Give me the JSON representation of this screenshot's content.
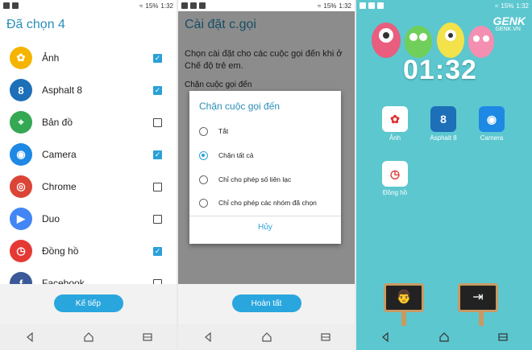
{
  "screen1": {
    "status": {
      "battery": "15%",
      "time": "1:32"
    },
    "title": "Đã chọn 4",
    "apps": [
      {
        "label": "Ảnh",
        "checked": true,
        "icon": "photos-pinwheel-icon",
        "glyph": "✿",
        "color": "#f4b400"
      },
      {
        "label": "Asphalt 8",
        "checked": true,
        "icon": "asphalt-8-icon",
        "glyph": "8",
        "color": "#1d6fb8"
      },
      {
        "label": "Bản đồ",
        "checked": false,
        "icon": "maps-icon",
        "glyph": "⌖",
        "color": "#34a853"
      },
      {
        "label": "Camera",
        "checked": true,
        "icon": "camera-icon",
        "glyph": "◉",
        "color": "#1e88e5"
      },
      {
        "label": "Chrome",
        "checked": false,
        "icon": "chrome-icon",
        "glyph": "◎",
        "color": "#db4437"
      },
      {
        "label": "Duo",
        "checked": false,
        "icon": "duo-icon",
        "glyph": "▶",
        "color": "#4285f4"
      },
      {
        "label": "Đồng hồ",
        "checked": true,
        "icon": "clock-icon",
        "glyph": "◷",
        "color": "#e53935"
      },
      {
        "label": "Facebook",
        "checked": false,
        "icon": "facebook-icon",
        "glyph": "f",
        "color": "#3b5998"
      }
    ],
    "button": "Kế tiếp"
  },
  "screen2": {
    "status": {
      "battery": "15%",
      "time": "1:32"
    },
    "title": "Cài đặt c.gọi",
    "description": "Chọn cài đặt cho các cuộc gọi đến khi ở Chế độ trẻ em.",
    "setting_label": "Chặn cuộc gọi đến",
    "dialog": {
      "title": "Chặn cuộc gọi đến",
      "options": [
        {
          "label": "Tắt",
          "selected": false
        },
        {
          "label": "Chặn tất cả",
          "selected": true
        },
        {
          "label": "Chỉ cho phép số liên lạc",
          "selected": false
        },
        {
          "label": "Chỉ cho phép các nhóm đã chọn",
          "selected": false
        }
      ],
      "cancel": "Hủy"
    },
    "button": "Hoàn tất"
  },
  "screen3": {
    "status": {
      "battery": "15%",
      "time": "1:32"
    },
    "clock": "01:32",
    "brand": "GENK",
    "brand_sub": "GENK.VN",
    "apps": [
      {
        "label": "Ảnh",
        "icon": "photos-pinwheel-icon",
        "glyph": "✿",
        "color": "#ffffff"
      },
      {
        "label": "Asphalt 8",
        "icon": "asphalt-8-icon",
        "glyph": "8",
        "color": "#1d6fb8"
      },
      {
        "label": "Camera",
        "icon": "camera-icon",
        "glyph": "◉",
        "color": "#1e88e5"
      },
      {
        "label": "Đồng hồ",
        "icon": "clock-icon",
        "glyph": "◷",
        "color": "#ffffff"
      }
    ],
    "signs": [
      {
        "icon": "parent-child-icon",
        "glyph": "👨"
      },
      {
        "icon": "exit-door-icon",
        "glyph": "⇥"
      }
    ]
  }
}
